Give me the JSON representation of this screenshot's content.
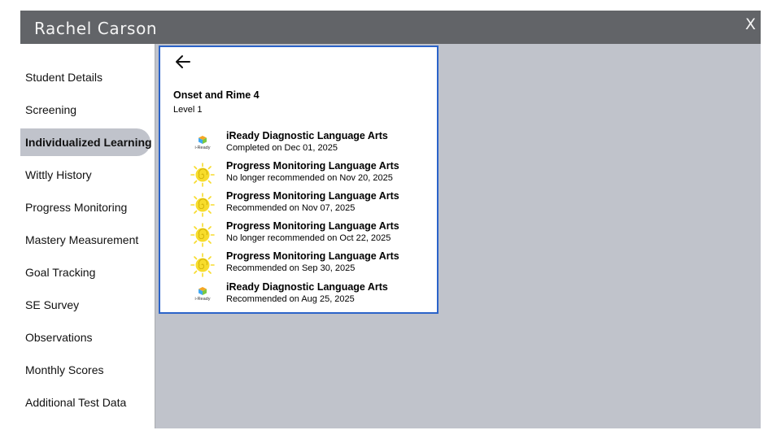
{
  "window": {
    "title": "Rachel Carson",
    "close_label": "X"
  },
  "sidebar": {
    "items": [
      {
        "label": "Student Details",
        "active": false
      },
      {
        "label": "Screening",
        "active": false
      },
      {
        "label": "Individualized Learning",
        "active": true
      },
      {
        "label": "Wittly History",
        "active": false
      },
      {
        "label": "Progress Monitoring",
        "active": false
      },
      {
        "label": "Mastery Measurement",
        "active": false
      },
      {
        "label": "Goal Tracking",
        "active": false
      },
      {
        "label": "SE Survey",
        "active": false
      },
      {
        "label": "Observations",
        "active": false
      },
      {
        "label": "Monthly Scores",
        "active": false
      },
      {
        "label": "Additional Test Data",
        "active": false
      }
    ]
  },
  "panel": {
    "back_icon": "arrow-left-icon",
    "title": "Onset and Rime 4",
    "level": "Level 1",
    "entries": [
      {
        "icon": "iready-icon",
        "icon_text": "i-Ready",
        "name": "iReady Diagnostic Language Arts",
        "status": "Completed on Dec 01, 2025"
      },
      {
        "icon": "sun-icon",
        "name": "Progress Monitoring Language Arts",
        "status": "No longer recommended on Nov 20, 2025"
      },
      {
        "icon": "sun-icon",
        "name": "Progress Monitoring Language Arts",
        "status": "Recommended on Nov 07, 2025"
      },
      {
        "icon": "sun-icon",
        "name": "Progress Monitoring Language Arts",
        "status": "No longer recommended on Oct 22, 2025"
      },
      {
        "icon": "sun-icon",
        "name": "Progress Monitoring Language Arts",
        "status": "Recommended on Sep 30, 2025"
      },
      {
        "icon": "iready-icon",
        "icon_text": "i-Ready",
        "name": "iReady Diagnostic Language Arts",
        "status": "Recommended on Aug 25, 2025"
      }
    ]
  },
  "colors": {
    "titlebar": "#626468",
    "content_bg": "#c0c3cb",
    "panel_border": "#2b63c9",
    "sun": "#f7dc2c"
  }
}
